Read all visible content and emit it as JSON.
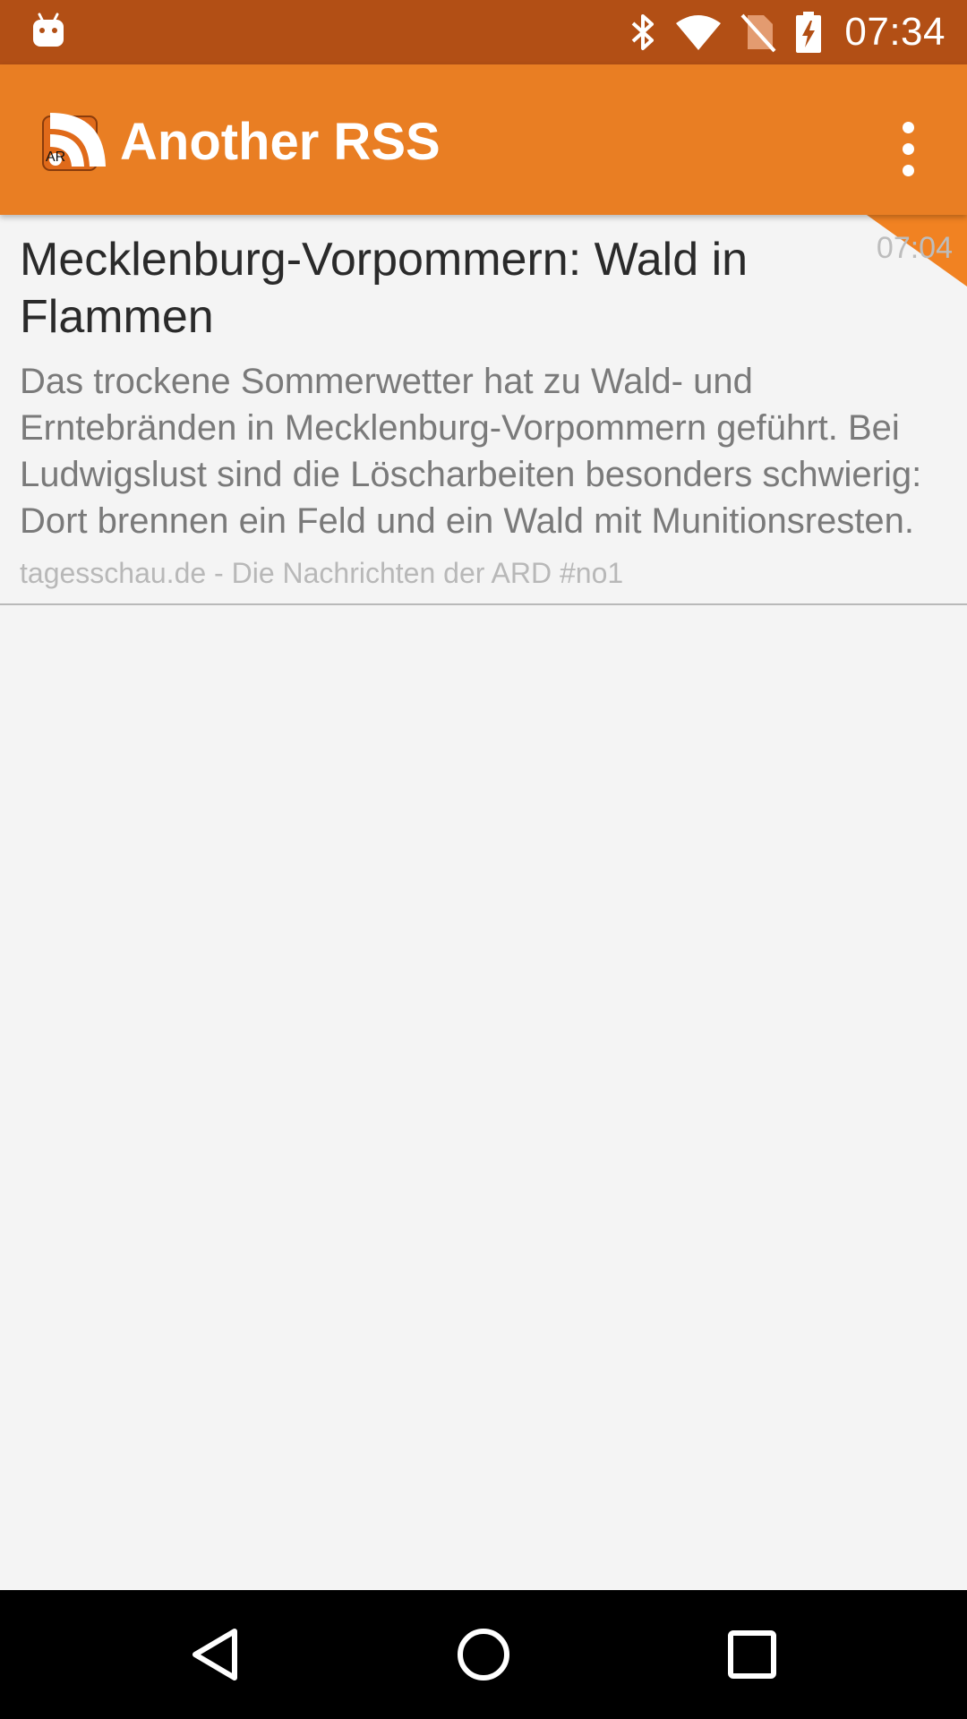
{
  "status_bar": {
    "time": "07:34",
    "icons": [
      "android-icon",
      "bluetooth-icon",
      "wifi-icon",
      "no-sim-icon",
      "battery-charging-icon"
    ]
  },
  "app_bar": {
    "logo_text": "AR",
    "title": "Another RSS",
    "menu_icon": "overflow-menu-icon"
  },
  "feed": {
    "items": [
      {
        "time": "07:04",
        "title": "Mecklenburg-Vorpommern: Wald in Flammen",
        "description": "Das trockene Sommerwetter hat zu Wald- und Erntebränden in Mecklenburg-Vorpommern geführt. Bei Ludwigslust sind die Löscharbeiten besonders schwierig: Dort brennen ein Feld und ein Wald mit Munitionsresten.",
        "source": "tagesschau.de - Die Nachrichten der ARD #no1"
      }
    ]
  },
  "nav_bar": {
    "icons": [
      "back-icon",
      "home-icon",
      "recents-icon"
    ]
  },
  "colors": {
    "status_bar": "#b24f15",
    "app_bar": "#e97e23",
    "accent_flag": "#f18222",
    "background": "#f4f4f4"
  }
}
